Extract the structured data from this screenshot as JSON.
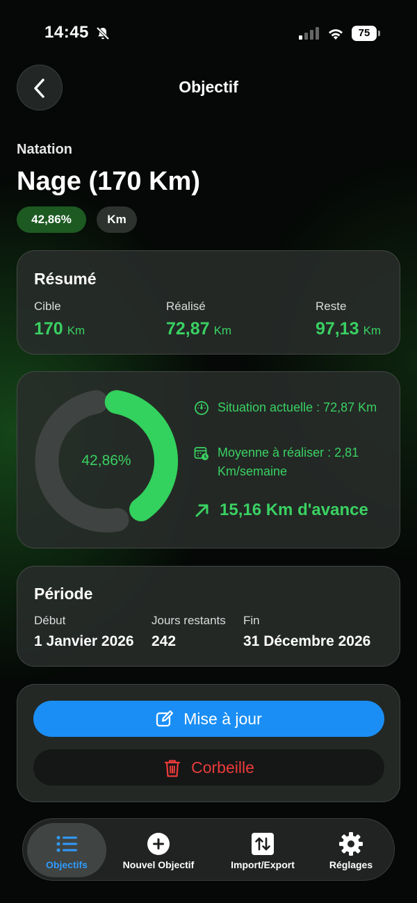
{
  "status": {
    "time": "14:45",
    "battery": "75"
  },
  "nav": {
    "title": "Objectif"
  },
  "goal": {
    "category": "Natation",
    "title": "Nage (170 Km)",
    "percent_badge": "42,86%",
    "unit_badge": "Km",
    "progress_fraction": 0.4286
  },
  "summary": {
    "title": "Résumé",
    "target_label": "Cible",
    "target_value": "170",
    "done_label": "Réalisé",
    "done_value": "72,87",
    "remaining_label": "Reste",
    "remaining_value": "97,13",
    "unit": "Km"
  },
  "progress": {
    "center_label": "42,86%",
    "current_situation": "Situation actuelle : 72,87 Km",
    "average_needed": "Moyenne à réaliser : 2,81 Km/semaine",
    "advance": "15,16 Km d'avance"
  },
  "period": {
    "title": "Période",
    "start_label": "Début",
    "start_value": "1 Janvier 2026",
    "days_left_label": "Jours restants",
    "days_left_value": "242",
    "end_label": "Fin",
    "end_value": "31 Décembre 2026"
  },
  "actions": {
    "update_label": "Mise à jour",
    "trash_label": "Corbeille"
  },
  "tabbar": {
    "items": [
      {
        "label": "Objectifs",
        "icon": "list-icon"
      },
      {
        "label": "Nouvel Objectif",
        "icon": "plus-circle-icon"
      },
      {
        "label": "Import/Export",
        "icon": "arrows-up-down-icon"
      },
      {
        "label": "Réglages",
        "icon": "gear-icon"
      }
    ]
  },
  "colors": {
    "accent_green": "#3ad162",
    "accent_blue": "#1a8ef5",
    "danger_red": "#ec3b3b",
    "active_tab": "#2f9bff"
  }
}
